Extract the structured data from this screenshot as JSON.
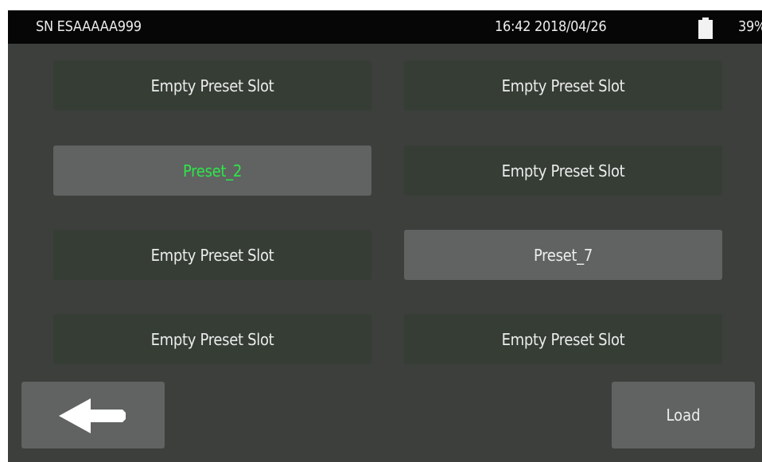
{
  "status_bar": {
    "serial": "SN ESAAAAA999",
    "datetime": "16:42 2018/04/26",
    "battery_percent": "39%",
    "battery_icon": "battery-icon"
  },
  "presets": [
    {
      "label": "Empty Preset Slot"
    },
    {
      "label": "Empty Preset Slot"
    },
    {
      "label": "Preset_2"
    },
    {
      "label": "Empty Preset Slot"
    },
    {
      "label": "Empty Preset Slot"
    },
    {
      "label": "Preset_7"
    },
    {
      "label": "Empty Preset Slot"
    },
    {
      "label": "Empty Preset Slot"
    }
  ],
  "footer": {
    "back_icon": "arrow-left-icon",
    "load_label": "Load"
  },
  "colors": {
    "background": "#3c3f3c",
    "empty_slot": "#353d35",
    "filled_slot": "#606361",
    "selected_text": "#2ee64a",
    "text": "#ececec"
  }
}
